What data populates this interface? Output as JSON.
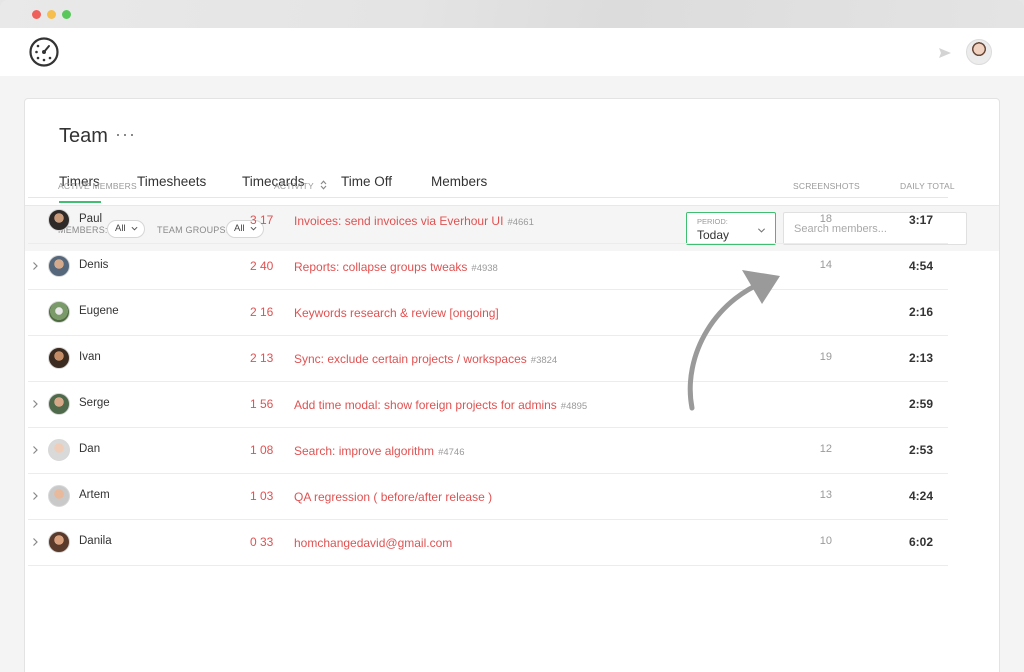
{
  "header": {
    "logo_icon": "stopwatch-icon",
    "notifications_icon": "bell-icon"
  },
  "page": {
    "title": "Team",
    "more_label": "···"
  },
  "tabs": [
    {
      "label": "Timers",
      "active": true
    },
    {
      "label": "Timesheets",
      "active": false
    },
    {
      "label": "Timecards",
      "active": false
    },
    {
      "label": "Time Off",
      "active": false
    },
    {
      "label": "Members",
      "active": false
    }
  ],
  "filters": {
    "members_label": "MEMBERS:",
    "members_value": "All",
    "team_groups_label": "TEAM GROUPS:",
    "team_groups_value": "All",
    "period_label": "PERIOD:",
    "period_value": "Today",
    "search_placeholder": "Search members..."
  },
  "columns": {
    "active_members": "ACTIVE MEMBERS",
    "activity": "ACTIVITY",
    "screenshots": "SCREENSHOTS",
    "daily_total": "DAILY TOTAL"
  },
  "colors": {
    "accent_green": "#3fbf6f",
    "activity_red": "#e05252"
  },
  "members": [
    {
      "name": "Paul",
      "expandable": false,
      "time": "3 17",
      "task": "Invoices: send invoices via Everhour UI",
      "task_id": "#4661",
      "screenshots": "18",
      "daily_total": "3:17"
    },
    {
      "name": "Denis",
      "expandable": true,
      "time": "2 40",
      "task": "Reports: collapse groups tweaks",
      "task_id": "#4938",
      "screenshots": "14",
      "daily_total": "4:54"
    },
    {
      "name": "Eugene",
      "expandable": false,
      "time": "2 16",
      "task": "Keywords research & review [ongoing]",
      "task_id": "",
      "screenshots": "",
      "daily_total": "2:16"
    },
    {
      "name": "Ivan",
      "expandable": false,
      "time": "2 13",
      "task": "Sync: exclude certain projects / workspaces",
      "task_id": "#3824",
      "screenshots": "19",
      "daily_total": "2:13"
    },
    {
      "name": "Serge",
      "expandable": true,
      "time": "1 56",
      "task": "Add time modal: show foreign projects for admins",
      "task_id": "#4895",
      "screenshots": "",
      "daily_total": "2:59"
    },
    {
      "name": "Dan",
      "expandable": true,
      "time": "1 08",
      "task": "Search: improve algorithm",
      "task_id": "#4746",
      "screenshots": "12",
      "daily_total": "2:53"
    },
    {
      "name": "Artem",
      "expandable": true,
      "time": "1 03",
      "task": "QA regression ( before/after release )",
      "task_id": "",
      "screenshots": "13",
      "daily_total": "4:24"
    },
    {
      "name": "Danila",
      "expandable": true,
      "time": "0 33",
      "task": "homchangedavid@gmail.com",
      "task_id": "",
      "screenshots": "10",
      "daily_total": "6:02"
    }
  ]
}
